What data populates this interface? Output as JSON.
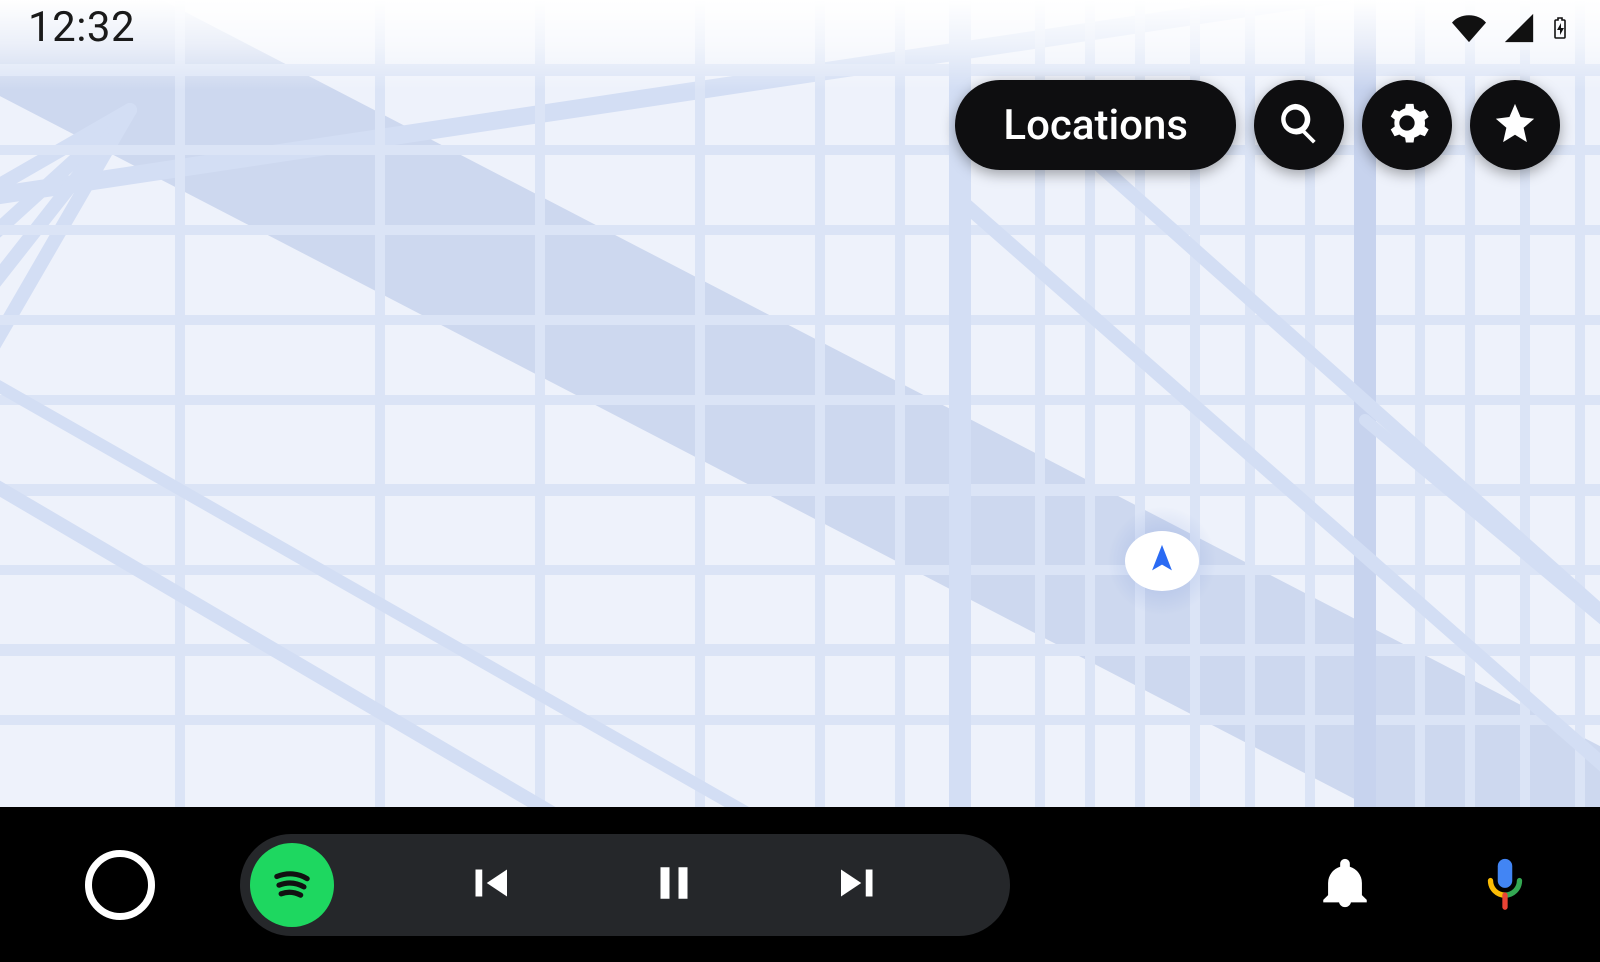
{
  "status_bar": {
    "time": "12:32",
    "wifi_icon": "wifi-icon",
    "cell_icon": "cell-signal-icon",
    "battery_icon": "battery-charging-icon"
  },
  "top_actions": {
    "locations_label": "Locations",
    "search_icon": "search-icon",
    "settings_icon": "gear-icon",
    "star_icon": "star-icon"
  },
  "location_puck": {
    "icon": "navigation-arrow-icon",
    "arrow_color": "#2a6af3"
  },
  "bottom_bar": {
    "home_icon": "home-launcher-icon",
    "media": {
      "app_icon": "spotify-icon",
      "app_accent": "#1ed760",
      "prev_icon": "skip-previous-icon",
      "pause_icon": "pause-icon",
      "next_icon": "skip-next-icon"
    },
    "notifications_icon": "bell-icon",
    "voice_icon": "google-mic-icon"
  },
  "colors": {
    "map_land": "#eef2fb",
    "map_road_minor": "#d3def4",
    "map_road_major": "#c7d3ee",
    "map_highway": "#cdd8ef",
    "chip_bg": "#0e0e10",
    "bottom_bg": "#000000"
  }
}
